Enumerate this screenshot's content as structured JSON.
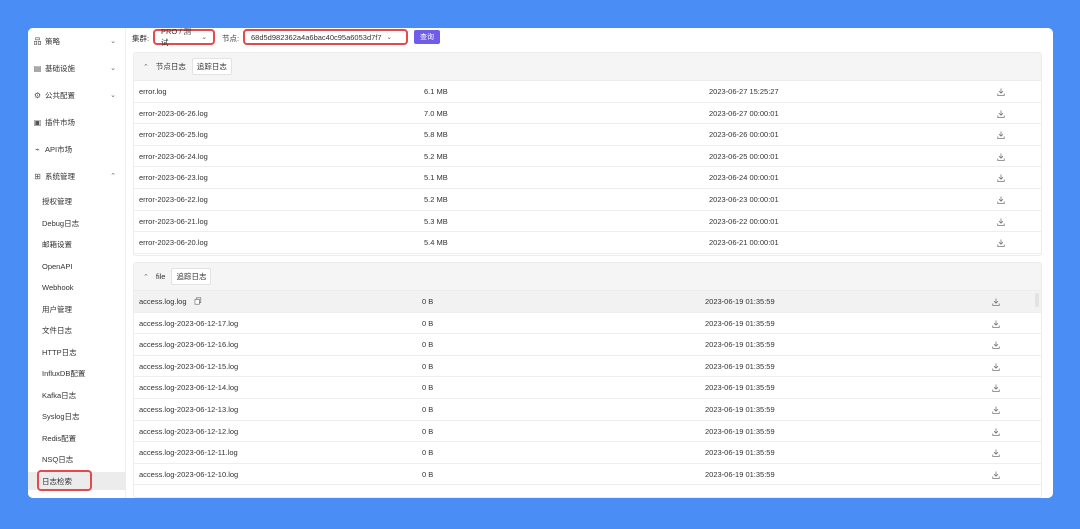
{
  "sidebar": {
    "groups": [
      {
        "label": "策略",
        "icon": "strategy-icon",
        "expanded": false
      },
      {
        "label": "基础设施",
        "icon": "infrastructure-icon",
        "expanded": false
      },
      {
        "label": "公共配置",
        "icon": "config-icon",
        "expanded": false
      },
      {
        "label": "插件市场",
        "icon": "plugin-icon"
      },
      {
        "label": "API市场",
        "icon": "api-icon"
      },
      {
        "label": "系统管理",
        "icon": "grid-icon",
        "expanded": true
      }
    ],
    "items": [
      "授权管理",
      "Debug日志",
      "邮箱设置",
      "OpenAPI",
      "Webhook",
      "用户管理",
      "文件日志",
      "HTTP日志",
      "InfluxDB配置",
      "Kafka日志",
      "Syslog日志",
      "Redis配置",
      "NSQ日志",
      "日志检索"
    ],
    "active_item": "日志检索"
  },
  "topbar": {
    "cluster_label": "集群:",
    "cluster_value": "PRO / 测试",
    "node_label": "节点:",
    "node_value": "68d5d982362a4a6bac40c95a6053d7f7",
    "query_label": "查询"
  },
  "node_log_panel": {
    "title": "节点日志",
    "tail_label": "追踪日志",
    "rows": [
      {
        "name": "error.log",
        "size": "6.1 MB",
        "time": "2023-06-27 15:25:27"
      },
      {
        "name": "error-2023-06-26.log",
        "size": "7.0 MB",
        "time": "2023-06-27 00:00:01"
      },
      {
        "name": "error-2023-06-25.log",
        "size": "5.8 MB",
        "time": "2023-06-26 00:00:01"
      },
      {
        "name": "error-2023-06-24.log",
        "size": "5.2 MB",
        "time": "2023-06-25 00:00:01"
      },
      {
        "name": "error-2023-06-23.log",
        "size": "5.1 MB",
        "time": "2023-06-24 00:00:01"
      },
      {
        "name": "error-2023-06-22.log",
        "size": "5.2 MB",
        "time": "2023-06-23 00:00:01"
      },
      {
        "name": "error-2023-06-21.log",
        "size": "5.3 MB",
        "time": "2023-06-22 00:00:01"
      },
      {
        "name": "error-2023-06-20.log",
        "size": "5.4 MB",
        "time": "2023-06-21 00:00:01"
      }
    ]
  },
  "file_panel": {
    "title": "file",
    "tail_label": "追踪日志",
    "rows": [
      {
        "name": "access.log.log",
        "size": "0 B",
        "time": "2023-06-19 01:35:59"
      },
      {
        "name": "access.log-2023-06-12-17.log",
        "size": "0 B",
        "time": "2023-06-19 01:35:59"
      },
      {
        "name": "access.log-2023-06-12-16.log",
        "size": "0 B",
        "time": "2023-06-19 01:35:59"
      },
      {
        "name": "access.log-2023-06-12-15.log",
        "size": "0 B",
        "time": "2023-06-19 01:35:59"
      },
      {
        "name": "access.log-2023-06-12-14.log",
        "size": "0 B",
        "time": "2023-06-19 01:35:59"
      },
      {
        "name": "access.log-2023-06-12-13.log",
        "size": "0 B",
        "time": "2023-06-19 01:35:59"
      },
      {
        "name": "access.log-2023-06-12-12.log",
        "size": "0 B",
        "time": "2023-06-19 01:35:59"
      },
      {
        "name": "access.log-2023-06-12-11.log",
        "size": "0 B",
        "time": "2023-06-19 01:35:59"
      },
      {
        "name": "access.log-2023-06-12-10.log",
        "size": "0 B",
        "time": "2023-06-19 01:35:59"
      }
    ]
  },
  "colors": {
    "background": "#4a8ef5",
    "accent": "#6f5ce8",
    "highlight_border": "#e5484d"
  },
  "icons": {
    "download": "download-icon",
    "copy": "copy-icon",
    "collapse": "chevron-up-icon",
    "expand": "chevron-down-icon"
  }
}
